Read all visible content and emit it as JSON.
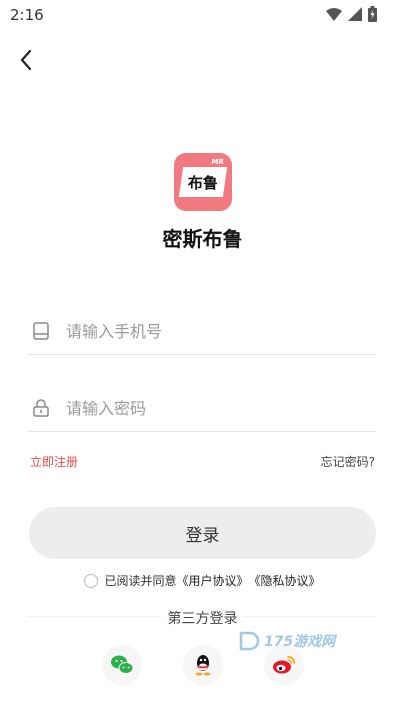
{
  "status_bar": {
    "time": "2:16"
  },
  "app": {
    "name": "密斯布鲁",
    "logo_text": "布鲁",
    "logo_mark": "MR"
  },
  "form": {
    "phone_placeholder": "请输入手机号",
    "password_placeholder": "请输入密码",
    "register_label": "立即注册",
    "forgot_label": "忘记密码?",
    "login_label": "登录"
  },
  "agreement": {
    "prefix": "已阅读并同意",
    "user_agreement": "《用户协议》",
    "privacy_policy": "《隐私协议》"
  },
  "third_party": {
    "title": "第三方登录",
    "providers": [
      "wechat-icon",
      "qq-icon",
      "weibo-icon"
    ]
  },
  "watermark": {
    "text": "175游戏网"
  },
  "colors": {
    "logo_bg": "#f07a80",
    "register": "#e94a4a",
    "button_bg": "#ededed"
  }
}
